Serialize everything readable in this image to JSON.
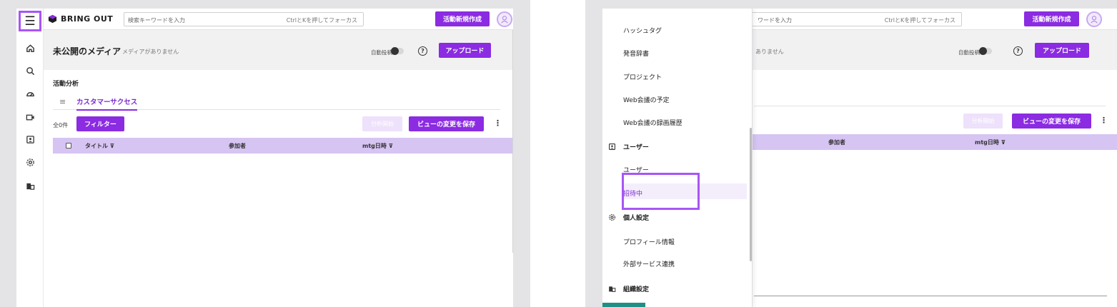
{
  "left": {
    "logo_text": "BRING OUT",
    "search": {
      "placeholder": "検索キーワードを入力",
      "hint": "CtrlとKを押してフォーカス"
    },
    "create_button": "活動新規作成",
    "page_title": "未公開のメディア",
    "page_subtitle": "メディアがありません",
    "auto_post_label": "自動投稿",
    "upload_button": "アップロード",
    "section_label": "活動分析",
    "tab_label": "カスタマーサクセス",
    "count_label": "全0件",
    "filter_button": "フィルター",
    "analysis_button": "分析開始",
    "save_view_button": "ビューの変更を保存",
    "columns": [
      "タイトル",
      "参加者",
      "mtg日時"
    ],
    "rail_icons": [
      "home-icon",
      "search-analytics-icon",
      "dashboard-icon",
      "video-icon",
      "user-badge-icon",
      "settings-icon",
      "organization-icon"
    ]
  },
  "right": {
    "search_placeholder_partial": "ワードを入力",
    "search_hint": "CtrlとKを押してフォーカス",
    "create_button": "活動新規作成",
    "subtitle_partial": "ありません",
    "auto_post_label": "自動投稿",
    "upload_button": "アップロード",
    "analysis_button": "分析開始",
    "save_view_button": "ビューの変更を保存",
    "columns": [
      "参加者",
      "mtg日時"
    ],
    "drawer": {
      "items_top": [
        "ハッシュタグ",
        "発音辞書",
        "プロジェクト",
        "Web会議の予定",
        "Web会議の録画履歴"
      ],
      "group_user": "ユーザー",
      "user_items": [
        "ユーザー",
        "招待中"
      ],
      "group_personal": "個人設定",
      "personal_items": [
        "プロフィール情報",
        "外部サービス連携"
      ],
      "group_org": "組織設定"
    }
  },
  "colors": {
    "accent": "#8b2be2",
    "highlight": "#a855f7",
    "table_header": "#d6c4f3"
  }
}
